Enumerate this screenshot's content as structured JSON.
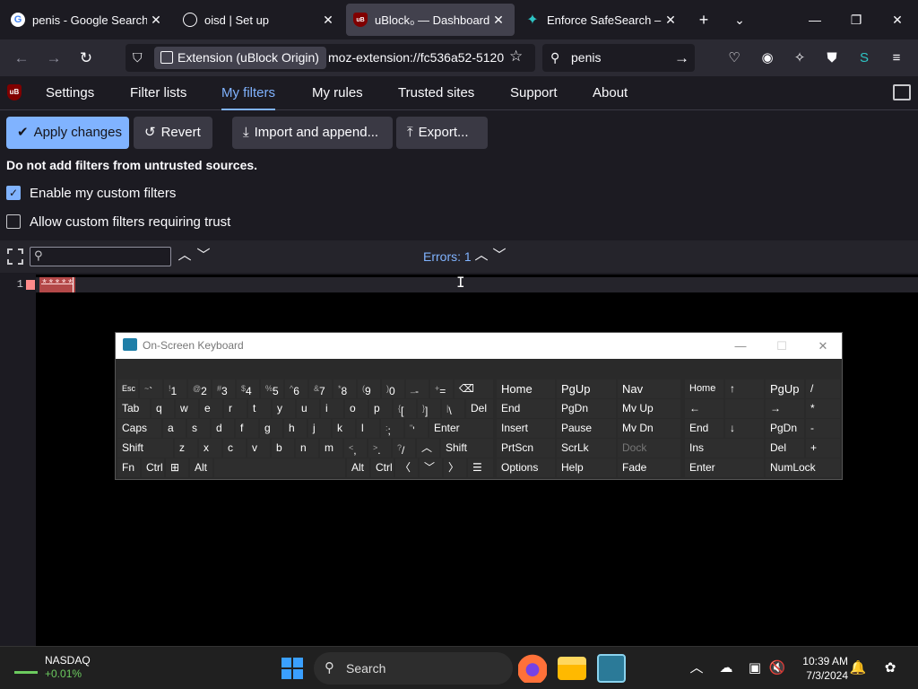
{
  "tabs": [
    {
      "title": "penis - Google Search",
      "favicon": "G"
    },
    {
      "title": "oisd | Set up",
      "favicon": "globe"
    },
    {
      "title": "uBlock₀ — Dashboard",
      "favicon": "uB"
    },
    {
      "title": "Enforce SafeSearch – Get",
      "favicon": "puzzle"
    }
  ],
  "navbar": {
    "identity_label": "Extension (uBlock Origin)",
    "url": "moz-extension://fc536a52-5120",
    "search_value": "penis"
  },
  "ubo_nav": {
    "items": [
      "Settings",
      "Filter lists",
      "My filters",
      "My rules",
      "Trusted sites",
      "Support",
      "About"
    ],
    "active": "My filters"
  },
  "toolbar": {
    "apply": "Apply changes",
    "revert": "Revert",
    "import": "Import and append...",
    "export": "Export..."
  },
  "warning": "Do not add filters from untrusted sources.",
  "options": {
    "enable_custom": {
      "label": "Enable my custom filters",
      "checked": true
    },
    "allow_trust": {
      "label": "Allow custom filters requiring trust",
      "checked": false
    }
  },
  "editor": {
    "errors_label": "Errors: 1",
    "line_number": "1",
    "line_text": "*****"
  },
  "osk": {
    "title": "On-Screen Keyboard"
  },
  "taskbar": {
    "stock_name": "NASDAQ",
    "stock_change": "+0.01%",
    "search_placeholder": "Search",
    "time": "10:39 AM",
    "date": "7/3/2024"
  },
  "colors": {
    "accent": "#80b3ff",
    "error": "#b34848",
    "bg": "#1c1b22"
  }
}
